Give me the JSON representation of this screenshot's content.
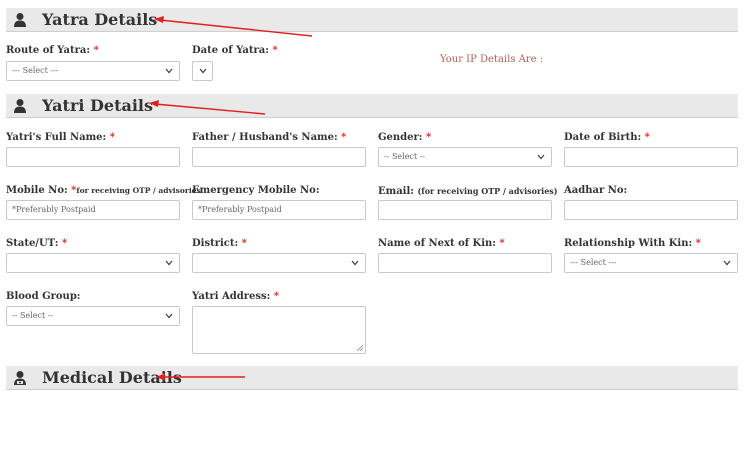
{
  "sections": {
    "yatra": {
      "title": "Yatra Details"
    },
    "yatri": {
      "title": "Yatri Details"
    },
    "medical": {
      "title": "Medical Details"
    }
  },
  "yatra": {
    "route_label": "Route of Yatra:",
    "route_value": "--- Select ---",
    "date_label": "Date of Yatra:",
    "date_value": "",
    "ip_text": "Your IP Details Are :"
  },
  "yatri": {
    "full_name_label": "Yatri's Full Name:",
    "father_label": "Father / Husband's Name:",
    "gender_label": "Gender:",
    "gender_value": "-- Select --",
    "dob_label": "Date of Birth:",
    "mobile_label": "Mobile No:",
    "mobile_note": "for receiving OTP / advisories",
    "mobile_placeholder": "*Preferably Postpaid",
    "emergency_label": "Emergency Mobile No:",
    "emergency_placeholder": "*Preferably Postpaid",
    "email_label": "Email:",
    "email_note": "(for receiving OTP / advisories)",
    "aadhar_label": "Aadhar No:",
    "state_label": "State/UT:",
    "district_label": "District:",
    "kin_label": "Name of Next of Kin:",
    "relationship_label": "Relationship With Kin:",
    "relationship_value": "--- Select ---",
    "blood_label": "Blood Group:",
    "blood_value": "-- Select --",
    "address_label": "Yatri Address:"
  },
  "required_mark": "*",
  "colors": {
    "arrow": "#e02020",
    "required": "#dd2222",
    "ip_text": "#b0605a",
    "section_bg": "#e9e9e9"
  }
}
